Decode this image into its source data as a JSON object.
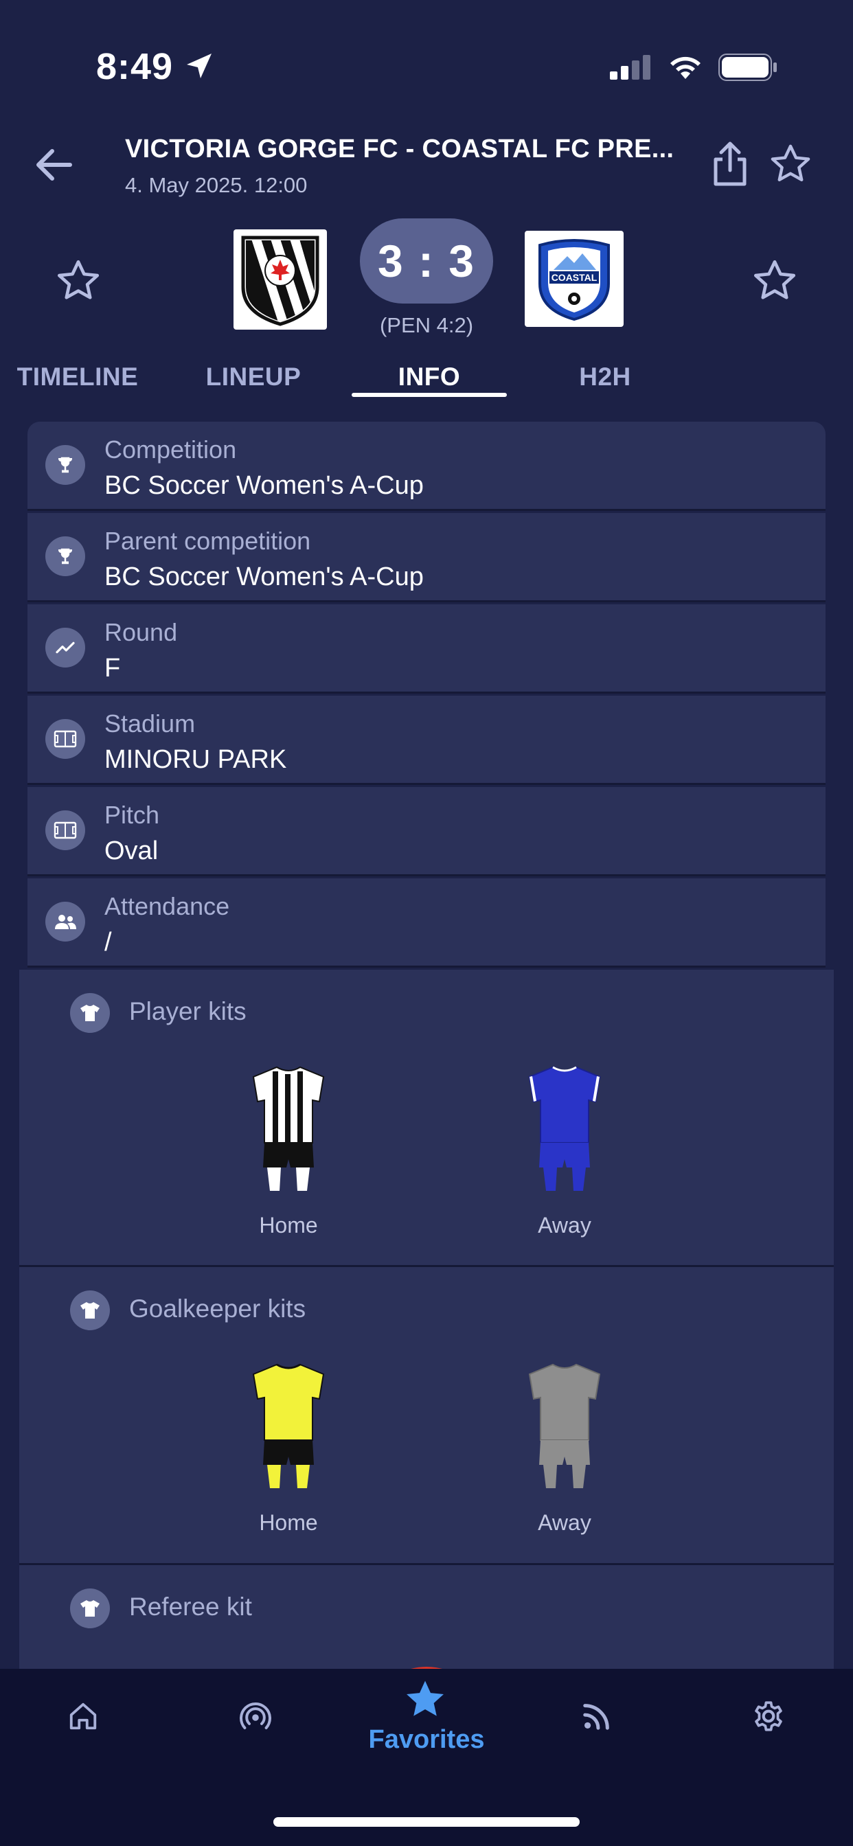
{
  "status_bar": {
    "time": "8:49"
  },
  "header": {
    "title": "VICTORIA GORGE FC - COASTAL FC PRE...",
    "date": "4. May 2025. 12:00"
  },
  "score": {
    "main": "3 : 3",
    "penalties": "(PEN 4:2)"
  },
  "tabs": [
    {
      "label": "TIMELINE",
      "active": false
    },
    {
      "label": "LINEUP",
      "active": false
    },
    {
      "label": "INFO",
      "active": true
    },
    {
      "label": "H2H",
      "active": false
    }
  ],
  "info_rows": [
    {
      "icon": "trophy-icon",
      "label": "Competition",
      "value": "BC Soccer Women's A-Cup"
    },
    {
      "icon": "trophy-icon",
      "label": "Parent competition",
      "value": "BC Soccer Women's A-Cup"
    },
    {
      "icon": "trend-icon",
      "label": "Round",
      "value": "F"
    },
    {
      "icon": "field-icon",
      "label": "Stadium",
      "value": "MINORU PARK"
    },
    {
      "icon": "field-icon",
      "label": "Pitch",
      "value": "Oval"
    },
    {
      "icon": "people-icon",
      "label": "Attendance",
      "value": "/"
    }
  ],
  "kits": {
    "player": {
      "title": "Player kits",
      "home_label": "Home",
      "away_label": "Away"
    },
    "goalkeeper": {
      "title": "Goalkeeper kits",
      "home_label": "Home",
      "away_label": "Away"
    },
    "referee": {
      "title": "Referee kit"
    }
  },
  "nav": {
    "items": [
      "home-icon",
      "podcast-icon",
      "star-icon",
      "feed-icon",
      "gear-icon"
    ],
    "active_label": "Favorites"
  },
  "colors": {
    "background": "#1c2146",
    "card": "#2b3159",
    "accent": "#4e9cf2",
    "score_pill": "#5a6291"
  }
}
